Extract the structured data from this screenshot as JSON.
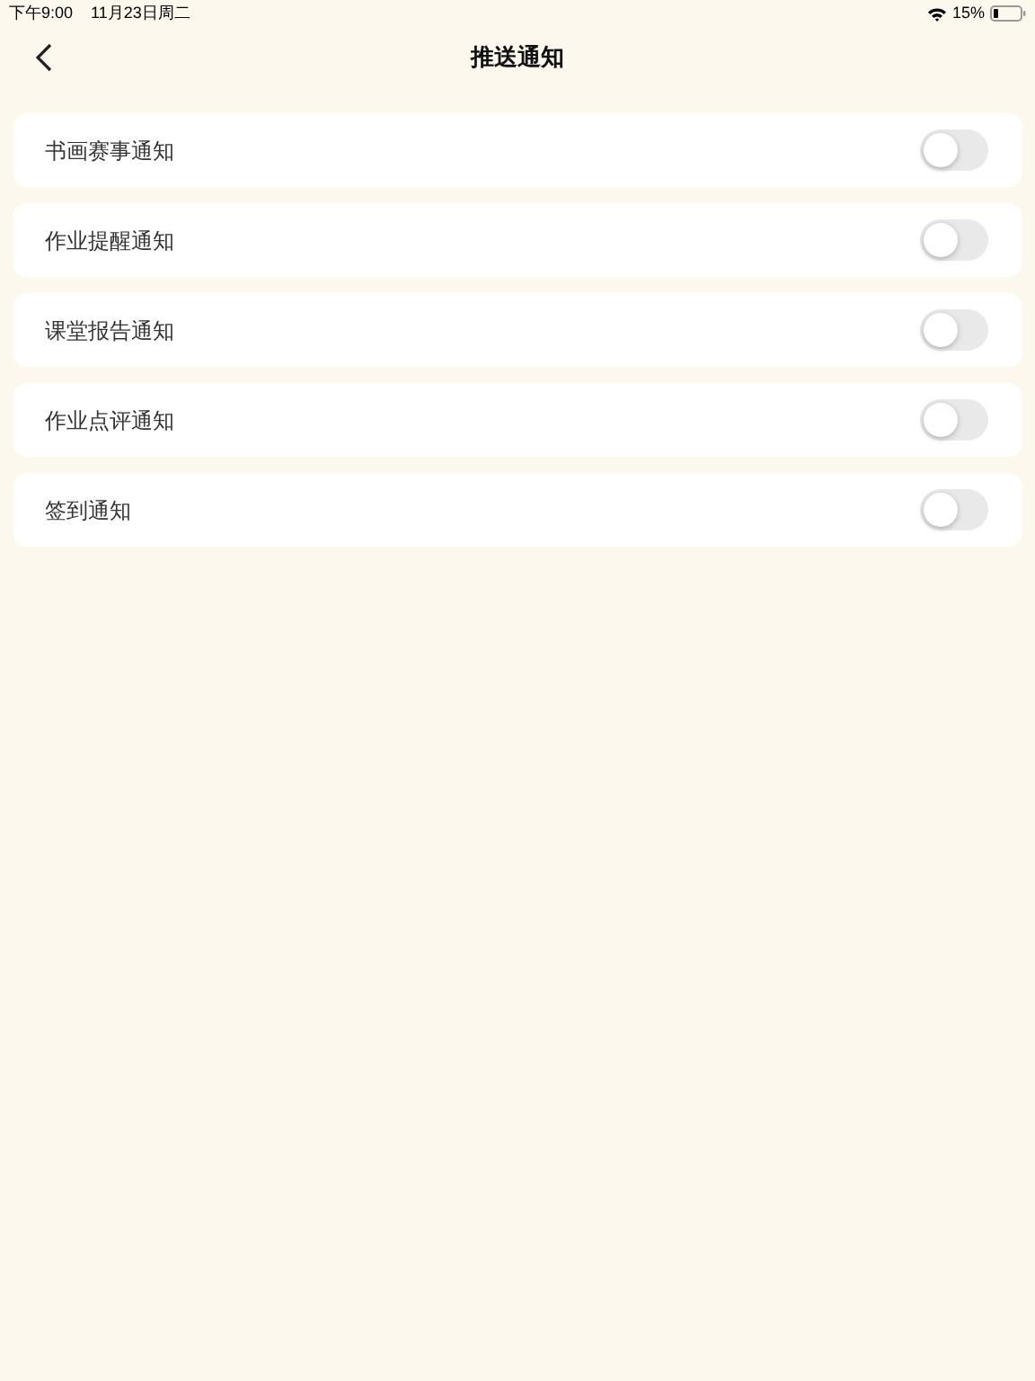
{
  "status_bar": {
    "time": "下午9:00",
    "date": "11月23日周二",
    "battery": "15%"
  },
  "nav_bar": {
    "title": "推送通知"
  },
  "settings": [
    {
      "label": "书画赛事通知",
      "on": false
    },
    {
      "label": "作业提醒通知",
      "on": false
    },
    {
      "label": "课堂报告通知",
      "on": false
    },
    {
      "label": "作业点评通知",
      "on": false
    },
    {
      "label": "签到通知",
      "on": false
    }
  ]
}
